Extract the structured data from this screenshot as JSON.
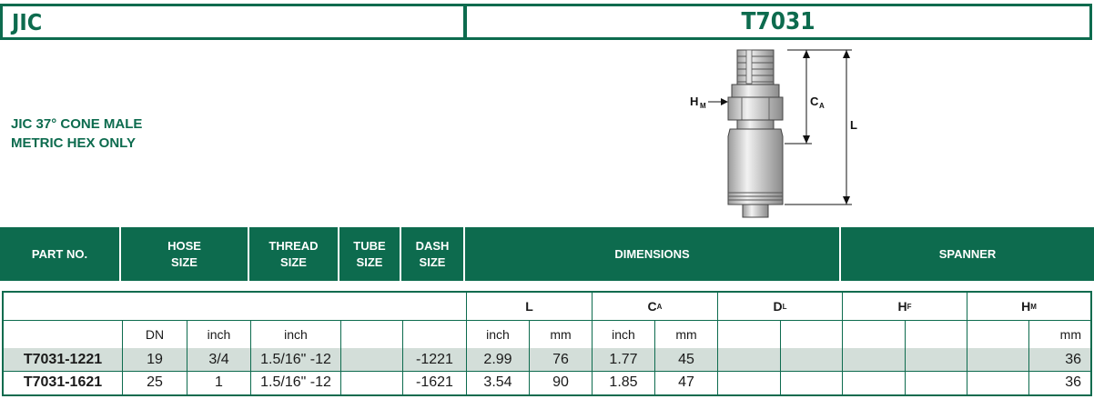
{
  "title": {
    "family": "JIC",
    "code": "T7031"
  },
  "description": [
    "JIC 37° CONE MALE",
    "METRIC HEX ONLY"
  ],
  "drawing_labels": {
    "hm": "H",
    "hm_sub": "M",
    "ca": "C",
    "ca_sub": "A",
    "l": "L"
  },
  "header": {
    "part_no": "PART NO.",
    "hose_size": [
      "HOSE",
      "SIZE"
    ],
    "thread_size": [
      "THREAD",
      "SIZE"
    ],
    "tube_size": [
      "TUBE",
      "SIZE"
    ],
    "dash_size": [
      "DASH",
      "SIZE"
    ],
    "dimensions": "DIMENSIONS",
    "spanner": "SPANNER"
  },
  "sub_header": {
    "L": "L",
    "CA": "C",
    "CA_sub": "A",
    "DL": "D",
    "DL_sub": "L",
    "HF": "H",
    "HF_sub": "F",
    "HM": "H",
    "HM_sub": "M"
  },
  "units": {
    "dn": "DN",
    "hose_inch": "inch",
    "thread_inch": "inch",
    "l_inch": "inch",
    "l_mm": "mm",
    "ca_inch": "inch",
    "ca_mm": "mm",
    "hm_mm": "mm"
  },
  "rows": [
    {
      "part": "T7031-1221",
      "dn": "19",
      "inch": "3/4",
      "thread": "1.5/16\" -12",
      "tube": "",
      "dash": "-1221",
      "l_inch": "2.99",
      "l_mm": "76",
      "ca_inch": "1.77",
      "ca_mm": "45",
      "hm_mm": "36"
    },
    {
      "part": "T7031-1621",
      "dn": "25",
      "inch": "1",
      "thread": "1.5/16\" -12",
      "tube": "",
      "dash": "-1621",
      "l_inch": "3.54",
      "l_mm": "90",
      "ca_inch": "1.85",
      "ca_mm": "47",
      "hm_mm": "36"
    }
  ],
  "colors": {
    "brand_green": "#0d6b4e",
    "row_shade": "#d3ded9"
  }
}
